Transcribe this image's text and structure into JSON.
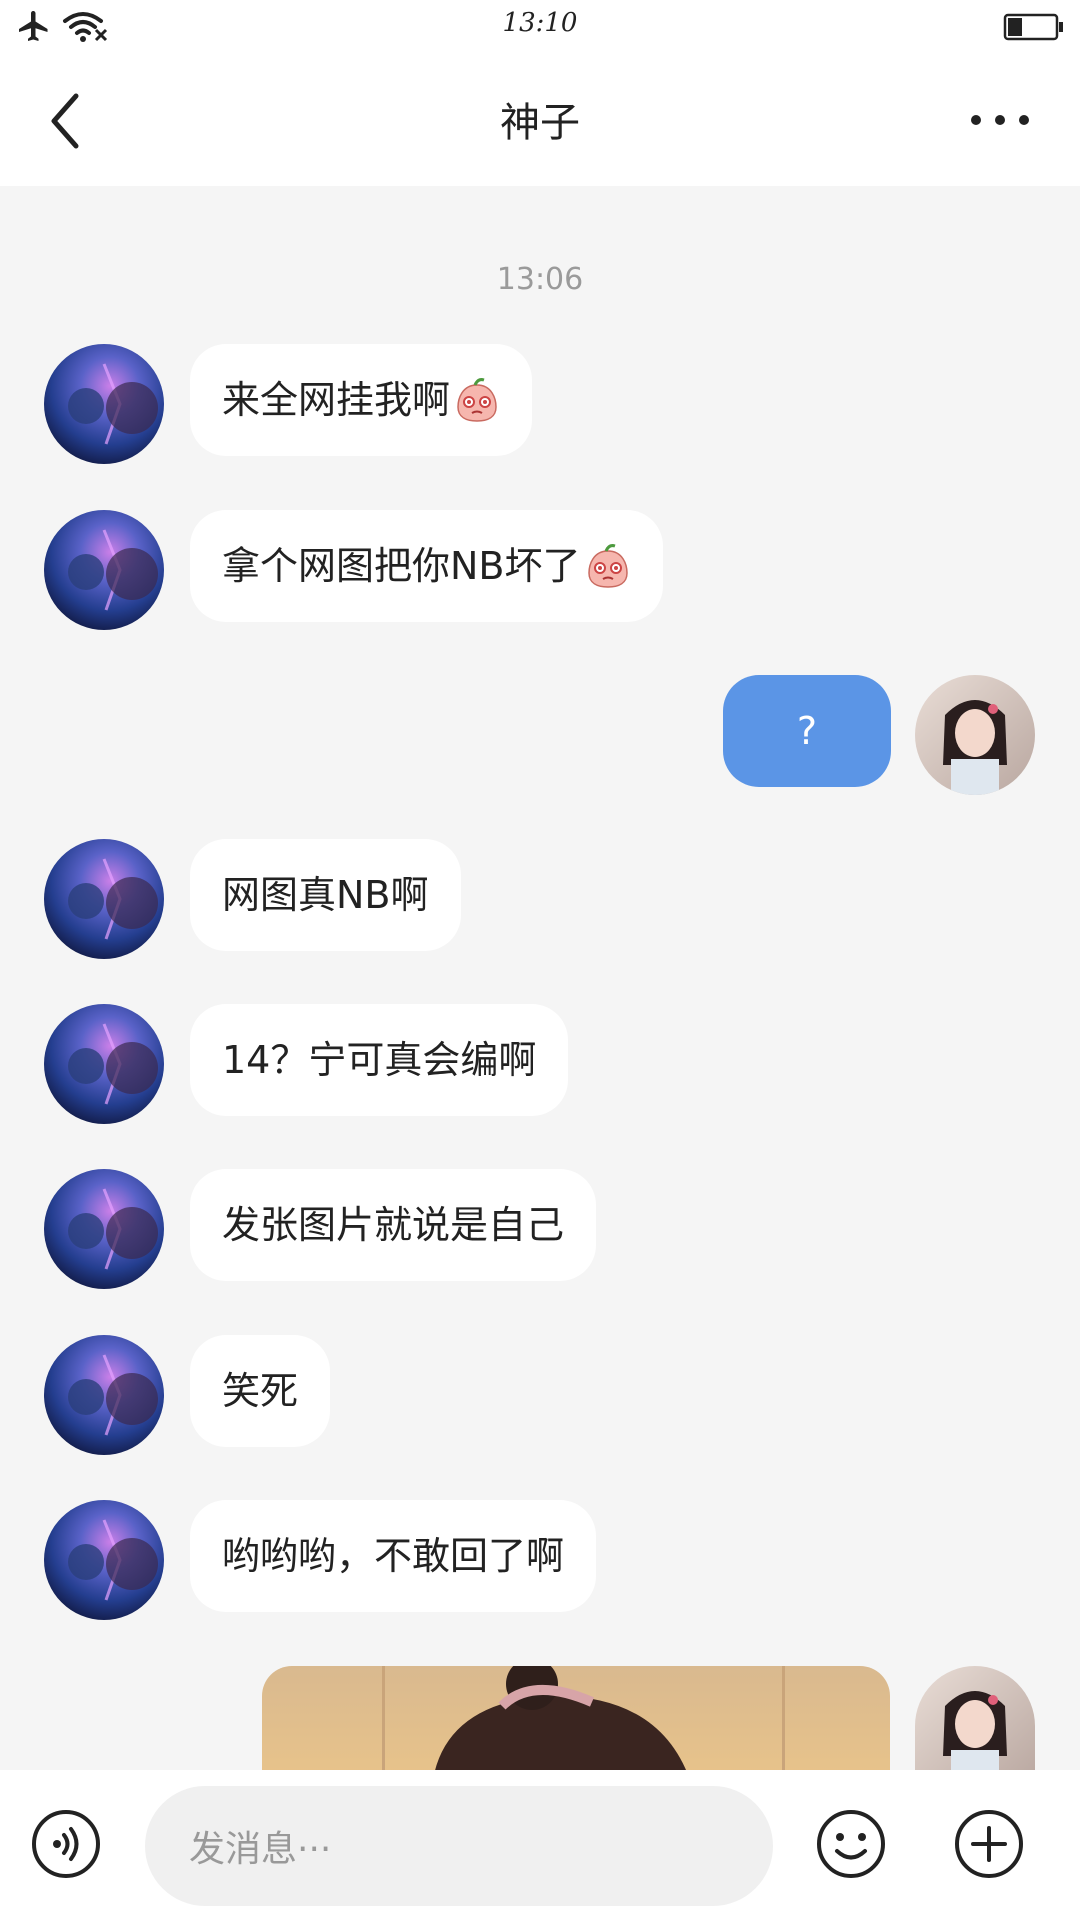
{
  "status_bar": {
    "time": "13:10",
    "icons": [
      "airplane-icon",
      "wifi-icon",
      "battery-icon"
    ]
  },
  "header": {
    "title": "神子",
    "back_icon": "chevron-left-icon",
    "more_icon": "more-dots-icon"
  },
  "chat": {
    "timestamp": "13:06",
    "messages": [
      {
        "from": "other",
        "text": "来全网挂我啊",
        "emoji": "pleading-peach-emoji"
      },
      {
        "from": "other",
        "text": "拿个网图把你NB坏了",
        "emoji": "pleading-peach-emoji"
      },
      {
        "from": "me",
        "text": "?"
      },
      {
        "from": "other",
        "text": "网图真NB啊"
      },
      {
        "from": "other",
        "text": "14？宁可真会编啊"
      },
      {
        "from": "other",
        "text": "发张图片就说是自己"
      },
      {
        "from": "other",
        "text": " 笑死"
      },
      {
        "from": "other",
        "text": "哟哟哟，不敢回了啊"
      },
      {
        "from": "me",
        "type": "image"
      }
    ]
  },
  "input_bar": {
    "placeholder": "发消息···",
    "voice_icon": "voice-icon",
    "emoji_icon": "smile-icon",
    "plus_icon": "plus-icon"
  },
  "colors": {
    "my_bubble": "#5b95e6",
    "background": "#f5f5f5",
    "other_bubble": "#ffffff"
  }
}
